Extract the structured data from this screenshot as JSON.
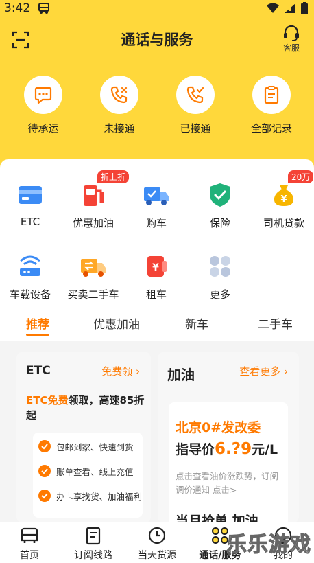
{
  "status_bar": {
    "time": "3:42"
  },
  "header": {
    "title": "通话与服务",
    "service_label": "客服"
  },
  "call_shortcuts": [
    {
      "label": "待承运",
      "icon": "waiting-chat-icon"
    },
    {
      "label": "未接通",
      "icon": "missed-call-icon"
    },
    {
      "label": "已接通",
      "icon": "connected-call-icon"
    },
    {
      "label": "全部记录",
      "icon": "records-clipboard-icon"
    }
  ],
  "services": [
    {
      "label": "ETC",
      "icon": "etc-card-icon"
    },
    {
      "label": "优惠加油",
      "icon": "fuel-pump-icon",
      "badge": "折上折"
    },
    {
      "label": "购车",
      "icon": "truck-icon"
    },
    {
      "label": "保险",
      "icon": "shield-check-icon"
    },
    {
      "label": "司机贷款",
      "icon": "money-bag-icon",
      "badge": "20万"
    },
    {
      "label": "车载设备",
      "icon": "router-icon"
    },
    {
      "label": "买卖二手车",
      "icon": "used-truck-icon"
    },
    {
      "label": "租车",
      "icon": "rent-car-icon"
    },
    {
      "label": "更多",
      "icon": "more-grid-icon"
    }
  ],
  "tabs": [
    {
      "label": "推荐",
      "active": true
    },
    {
      "label": "优惠加油",
      "active": false
    },
    {
      "label": "新车",
      "active": false
    },
    {
      "label": "二手车",
      "active": false
    }
  ],
  "etc_card": {
    "title": "ETC",
    "link": "免费领",
    "desc_highlight": "ETC免费",
    "desc_rest": "领取，高速85折起",
    "features": [
      "包邮到家、快速到货",
      "账单查看、线上充值",
      "办卡享找货、加油福利"
    ]
  },
  "fuel_card": {
    "title": "加油",
    "link": "查看更多",
    "line1": "北京0#发改委",
    "price_prefix": "指导价",
    "price": "6.?9",
    "price_unit": "元/L",
    "note": "点击查看油价涨跌势，订阅调价通知 点击>",
    "line3": "当月抢单 加油"
  },
  "bottom_nav": [
    {
      "label": "首页",
      "icon": "home-truck-icon",
      "active": false
    },
    {
      "label": "订阅线路",
      "icon": "subscribe-route-icon",
      "active": false
    },
    {
      "label": "当天货源",
      "icon": "clock-icon",
      "active": false
    },
    {
      "label": "通话/服务",
      "icon": "service-grid-icon",
      "active": true
    },
    {
      "label": "我的",
      "icon": "profile-icon",
      "active": false
    }
  ],
  "watermark": "乐乐游戏",
  "colors": {
    "accent": "#ff7a00",
    "header_bg": "#ffd83b",
    "badge": "#f44336"
  }
}
